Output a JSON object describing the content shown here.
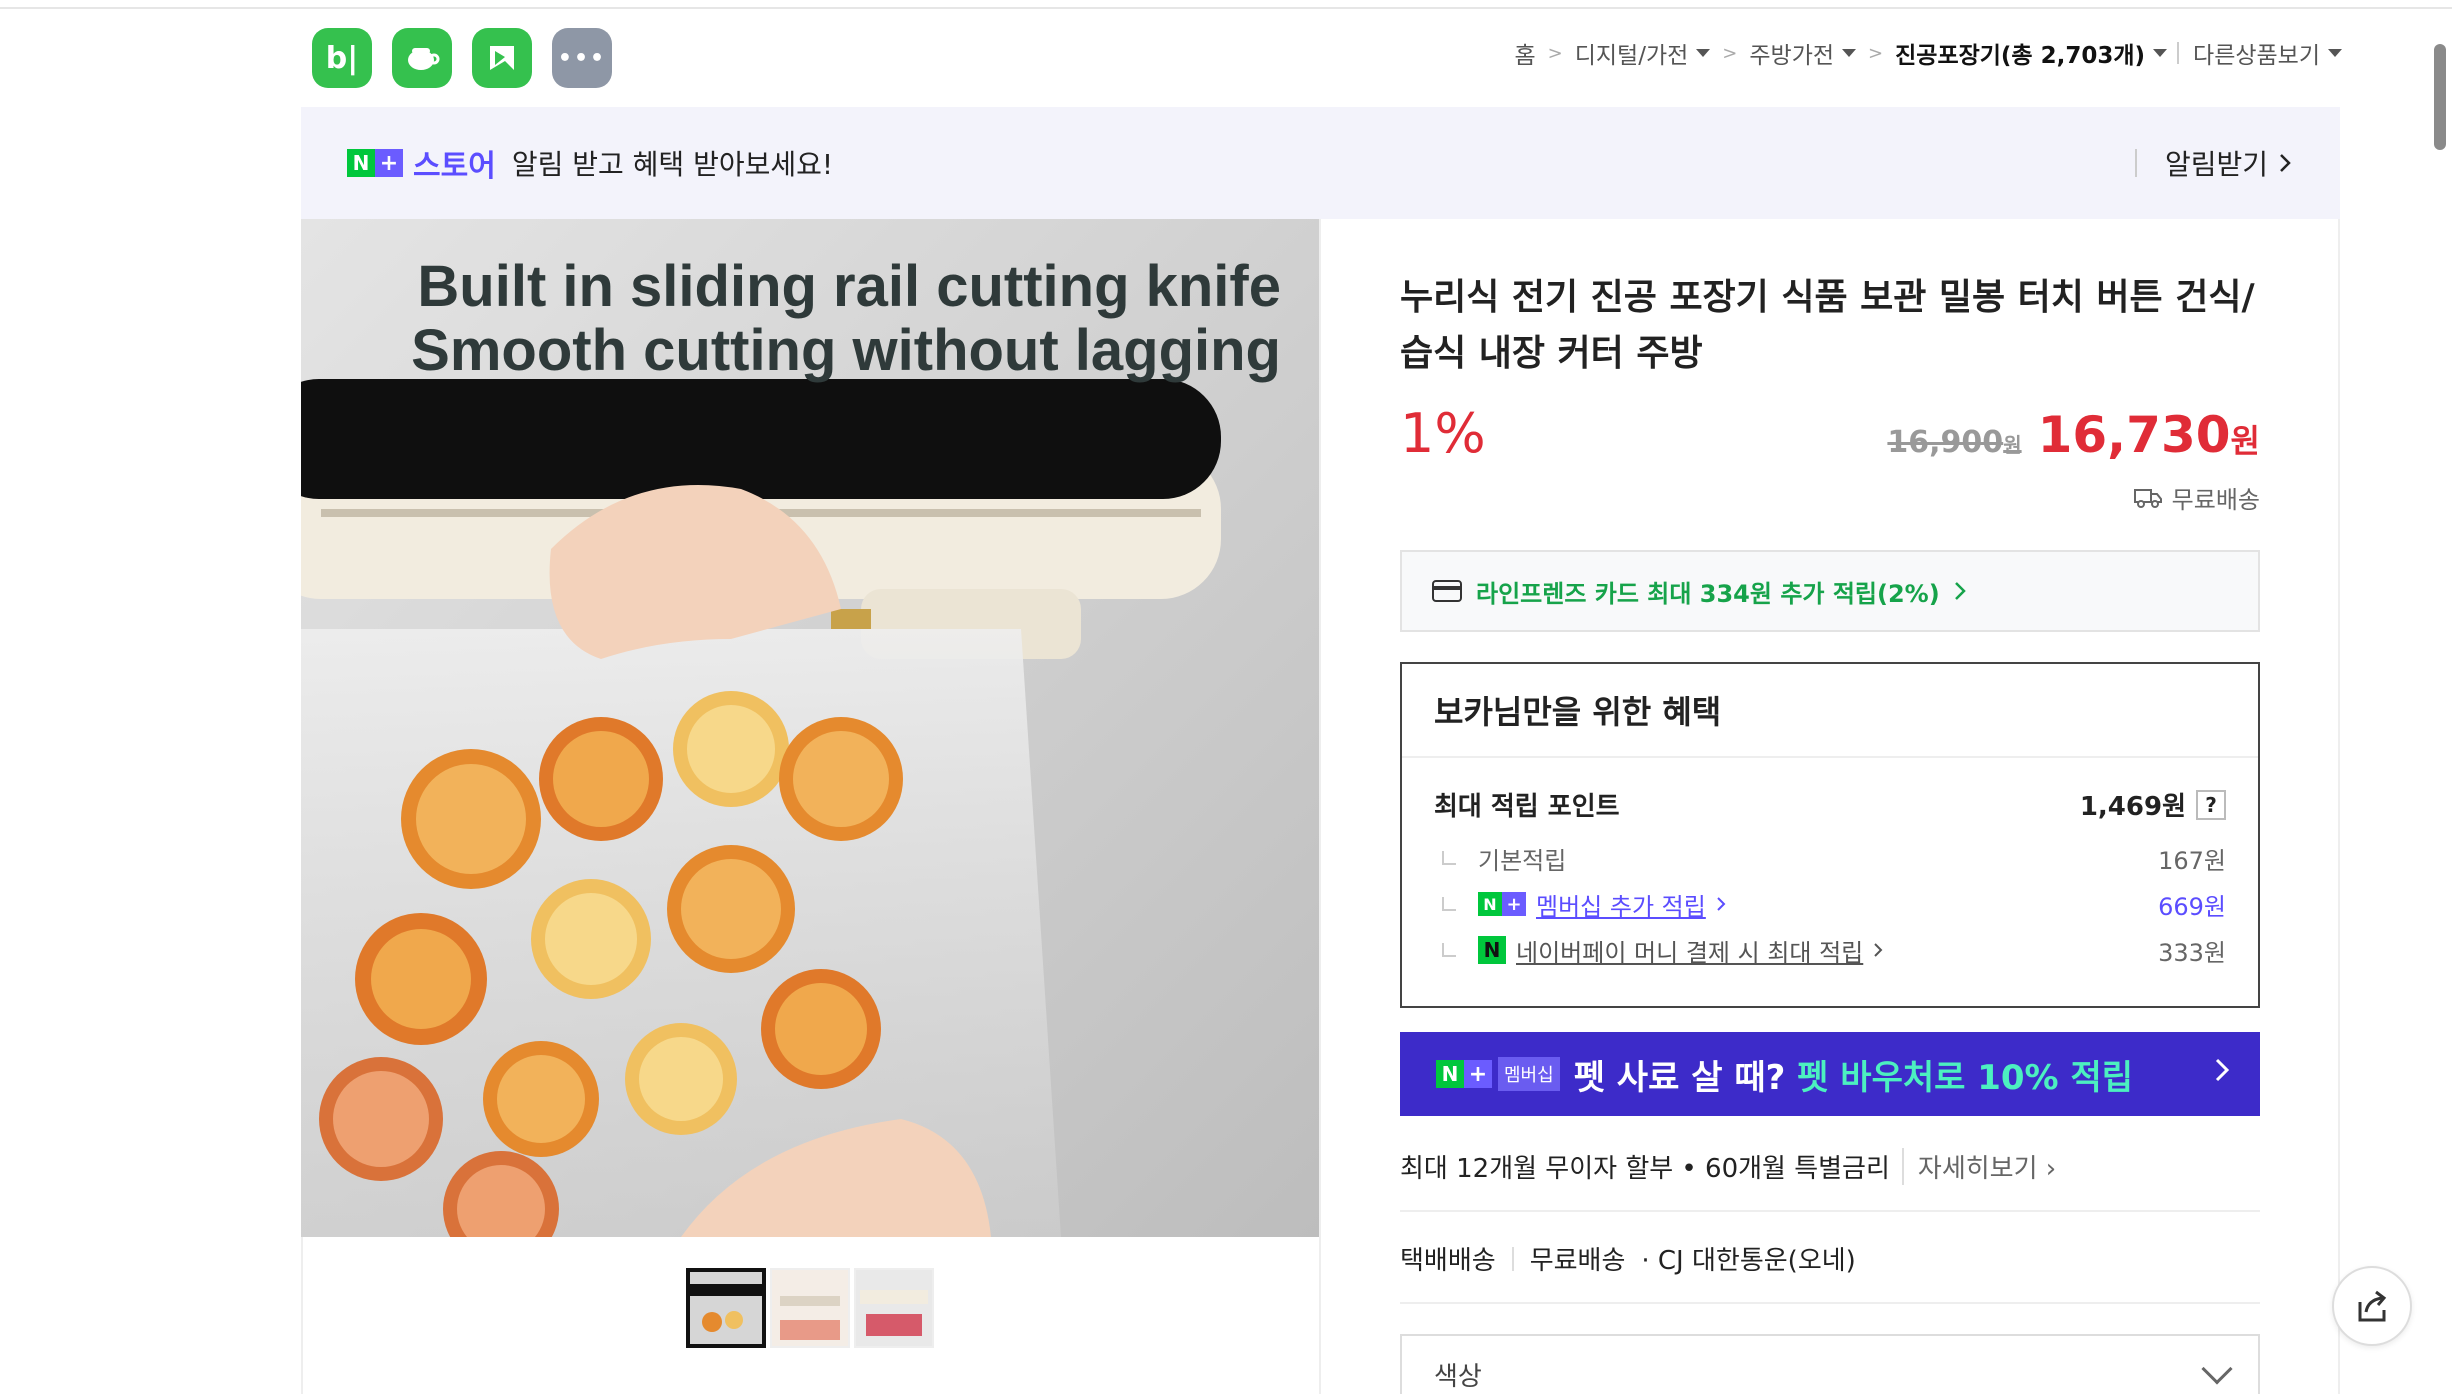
{
  "header": {
    "apps": [
      {
        "icon": "blog-icon",
        "label": "b|"
      },
      {
        "icon": "cafe-icon",
        "label": ""
      },
      {
        "icon": "kin-icon",
        "label": ""
      },
      {
        "icon": "more-icon",
        "label": "•••"
      }
    ],
    "breadcrumb": {
      "home": "홈",
      "cat1": "디지털/가전",
      "cat2": "주방가전",
      "cat3": "진공포장기(총 2,703개)",
      "other": "다른상품보기"
    }
  },
  "store_banner": {
    "store_word": "스토어",
    "message": "알림 받고 혜택 받아보세요!",
    "alarm_label": "알림받기"
  },
  "product_image": {
    "caption_line1": "Built in sliding rail cutting knife",
    "caption_line2": "Smooth cutting without lagging"
  },
  "product": {
    "title": "누리식 전기 진공 포장기 식품 보관 밀봉 터치 버튼 건식/습식 내장 커터 주방",
    "discount": "1%",
    "original_price": "16,900",
    "original_unit": "원",
    "sale_price": "16,730",
    "sale_unit": "원",
    "shipping": "무료배송"
  },
  "card_offer": "라인프렌즈 카드 최대 334원 추가 적립(2%)",
  "benefits": {
    "title": "보카님만을 위한 혜택",
    "max_points_label": "최대 적립 포인트",
    "max_points_value": "1,469원",
    "help": "?",
    "rows": [
      {
        "label": "기본적립",
        "value": "167원"
      },
      {
        "label": "멤버십 추가 적립",
        "value": "669원"
      },
      {
        "label": "네이버페이 머니 결제 시 최대 적립",
        "value": "333원"
      }
    ]
  },
  "membership_banner": {
    "tag": "멤버십",
    "text": "펫 사료 살 때?",
    "highlight": "펫 바우처로 10% 적립"
  },
  "installment": {
    "text": "최대 12개월 무이자 할부 • 60개월 특별금리",
    "more": "자세히보기"
  },
  "delivery": {
    "type": "택배배송",
    "fee": "무료배송",
    "carrier": "· CJ 대한통운(오네)"
  },
  "option_select": {
    "label": "색상"
  },
  "colors": {
    "naver_green": "#00c73c",
    "nplus_purple": "#5b4dff",
    "sale_red": "#e02c37",
    "member_bg": "#3d2bc9"
  }
}
